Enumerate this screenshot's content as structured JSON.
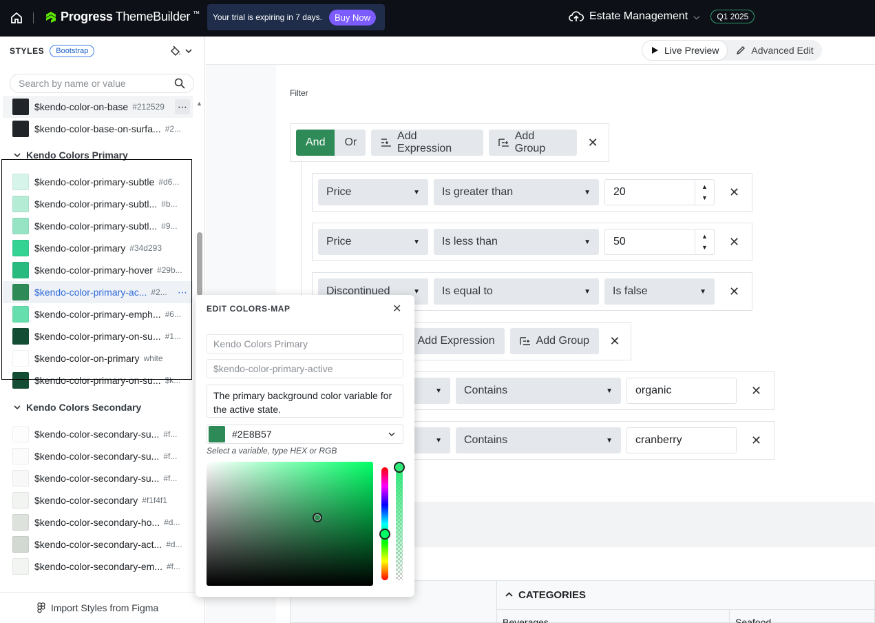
{
  "topbar": {
    "logo_brand": "Progress",
    "logo_product": "ThemeBuilder",
    "logo_tm": "™",
    "trial_text": "Your trial is expiring in 7 days.",
    "buy_label": "Buy Now",
    "project_name": "Estate Management",
    "release_badge": "Q1 2025"
  },
  "sidebar": {
    "styles_label": "STYLES",
    "framework_chip": "Bootstrap",
    "search_placeholder": "Search by name or value",
    "rows_top": [
      {
        "name": "$kendo-color-on-base",
        "hex": "#212529",
        "color": "#212529"
      },
      {
        "name": "$kendo-color-base-on-surfa...",
        "hex": "#2...",
        "color": "#212529"
      }
    ],
    "group_primary": "Kendo Colors Primary",
    "rows_primary": [
      {
        "name": "$kendo-color-primary-subtle",
        "hex": "#d6...",
        "color": "#d6f4ea"
      },
      {
        "name": "$kendo-color-primary-subtl...",
        "hex": "#b...",
        "color": "#b5ecd6"
      },
      {
        "name": "$kendo-color-primary-subtl...",
        "hex": "#9...",
        "color": "#96e4c4"
      },
      {
        "name": "$kendo-color-primary",
        "hex": "#34d293",
        "color": "#34d293"
      },
      {
        "name": "$kendo-color-primary-hover",
        "hex": "#29b...",
        "color": "#29ba80"
      },
      {
        "name": "$kendo-color-primary-ac...",
        "hex": "#2...",
        "color": "#2e8b57"
      },
      {
        "name": "$kendo-color-primary-emph...",
        "hex": "#6...",
        "color": "#67deae"
      },
      {
        "name": "$kendo-color-primary-on-su...",
        "hex": "#1...",
        "color": "#134d33"
      },
      {
        "name": "$kendo-color-on-primary",
        "hex": "white",
        "color": "#ffffff"
      },
      {
        "name": "$kendo-color-primary-on-su...",
        "hex": "$k...",
        "color": "#134d33"
      }
    ],
    "group_secondary": "Kendo Colors Secondary",
    "rows_secondary": [
      {
        "name": "$kendo-color-secondary-su...",
        "hex": "#f...",
        "color": "#fdfdfd"
      },
      {
        "name": "$kendo-color-secondary-su...",
        "hex": "#f...",
        "color": "#fbfbfb"
      },
      {
        "name": "$kendo-color-secondary-su...",
        "hex": "#f...",
        "color": "#f7f8f7"
      },
      {
        "name": "$kendo-color-secondary",
        "hex": "#f1f4f1",
        "color": "#f1f4f1"
      },
      {
        "name": "$kendo-color-secondary-ho...",
        "hex": "#d...",
        "color": "#dde2dd"
      },
      {
        "name": "$kendo-color-secondary-act...",
        "hex": "#d...",
        "color": "#d2d9d2"
      },
      {
        "name": "$kendo-color-secondary-em...",
        "hex": "#f...",
        "color": "#f3f5f3"
      }
    ],
    "figma_label": "Import Styles from Figma"
  },
  "header": {
    "live_preview": "Live Preview",
    "advanced_edit": "Advanced Edit"
  },
  "filter": {
    "label": "Filter",
    "and_label": "And",
    "or_label": "Or",
    "add_expression": "Add Expression",
    "add_group": "Add Group",
    "expr1": {
      "field": "Price",
      "op": "Is greater than",
      "value": "20"
    },
    "expr2": {
      "field": "Price",
      "op": "Is less than",
      "value": "50"
    },
    "expr3": {
      "field": "Discontinued",
      "op": "Is equal to",
      "value": "Is false"
    },
    "expr4": {
      "op": "Contains",
      "value": "organic"
    },
    "expr5": {
      "op": "Contains",
      "value": "cranberry"
    }
  },
  "grid": {
    "categories_header": "CATEGORIES",
    "sub1": "Beverages",
    "sub2": "Seafood"
  },
  "popup": {
    "title": "EDIT COLORS-MAP",
    "group_placeholder": "Kendo Colors Primary",
    "name_placeholder": "$kendo-color-primary-active",
    "description": "The primary background color variable for the active state.",
    "color_value": "#2E8B57",
    "color_swatch": "#2e8b57",
    "hint": "Select a variable, type HEX or RGB"
  }
}
